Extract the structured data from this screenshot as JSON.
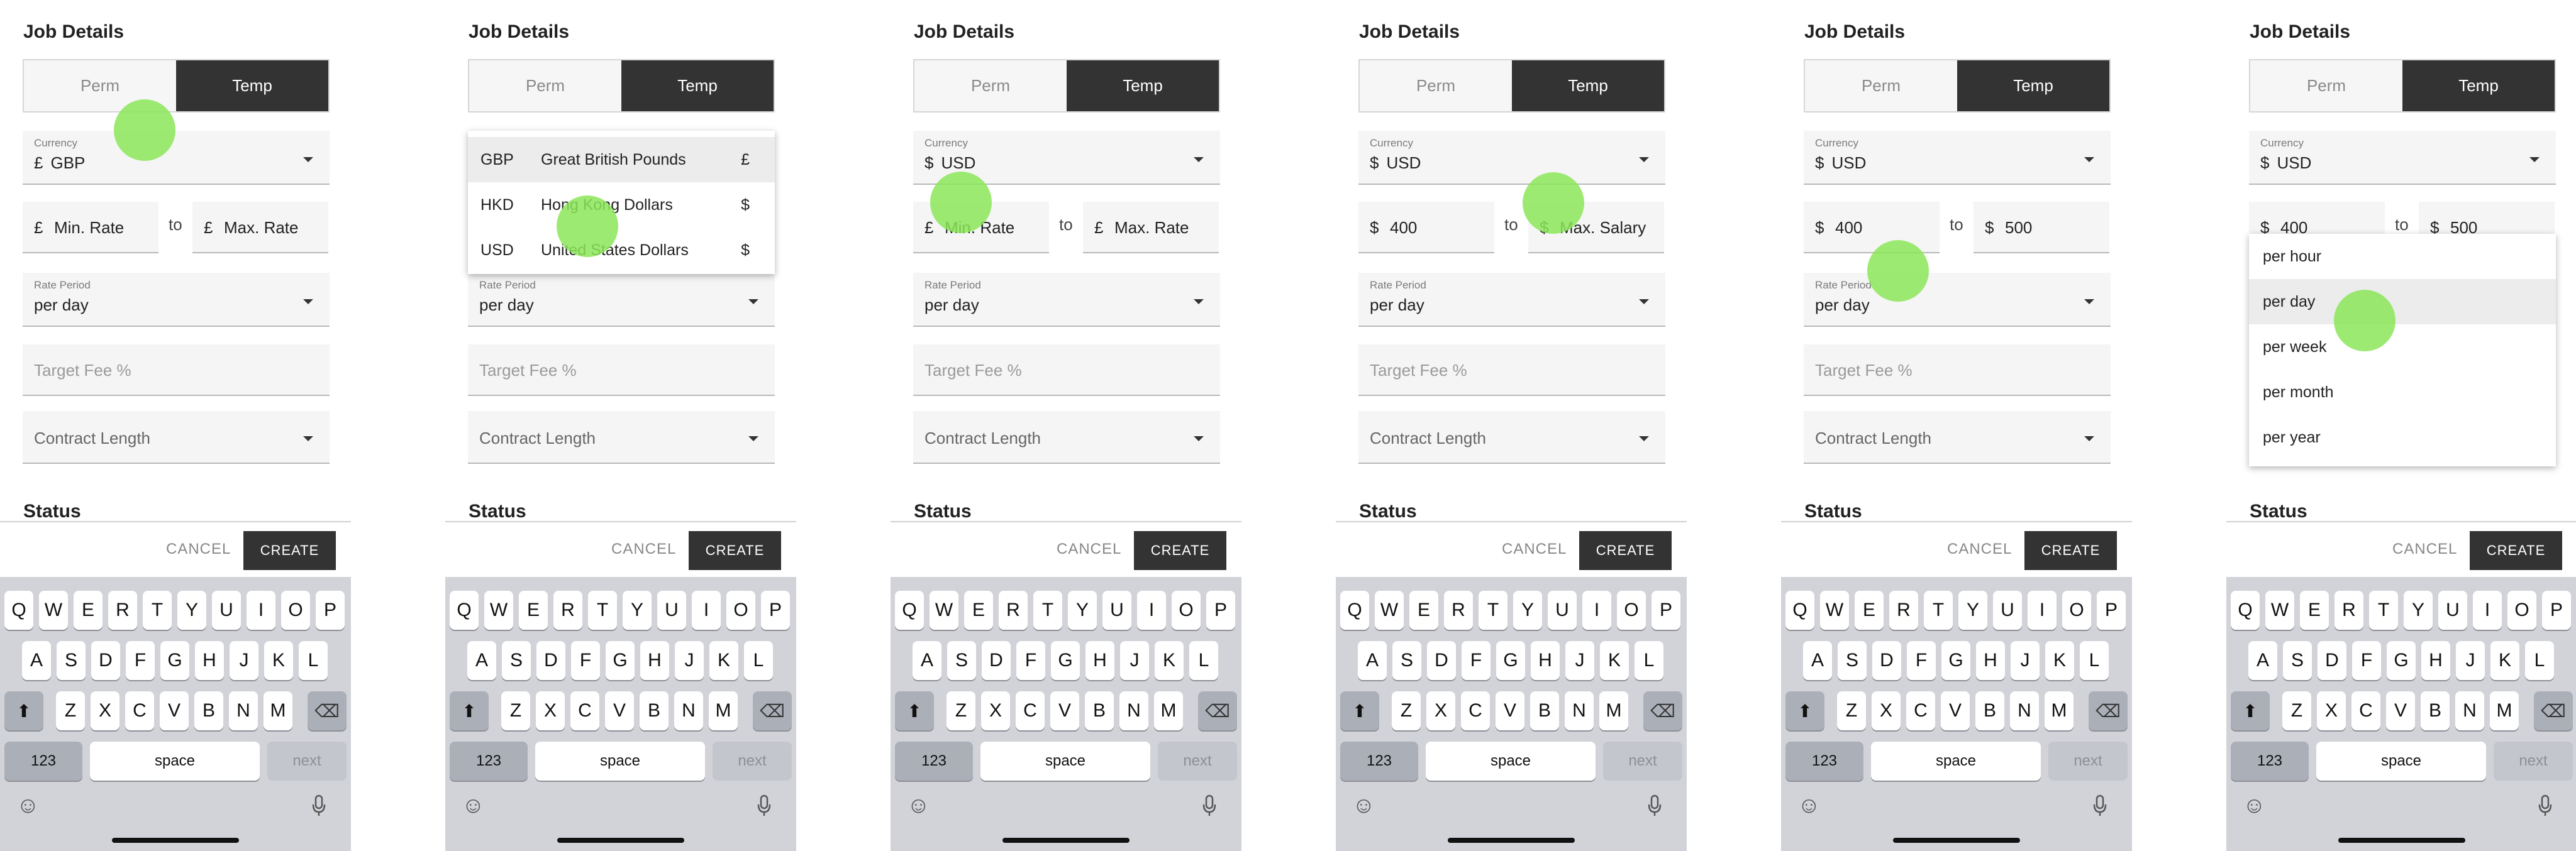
{
  "form": {
    "job_details": "Job Details",
    "perm": "Perm",
    "temp": "Temp",
    "currency_label": "Currency",
    "to": "to",
    "min_rate_placeholder": "Min. Rate",
    "max_rate_placeholder": "Max. Rate",
    "max_salary_placeholder": "Max. Salary",
    "rate_period_label": "Rate Period",
    "rate_period_value": "per day",
    "target_fee_placeholder": "Target Fee %",
    "contract_length_placeholder": "Contract Length",
    "status": "Status",
    "cancel": "CANCEL",
    "create": "CREATE"
  },
  "panels": [
    {
      "currency_symbol": "£",
      "currency_code": "GBP",
      "min_symbol": "£",
      "min_value": "",
      "max_symbol": "£",
      "max_value": ""
    },
    {
      "currency_symbol": "£",
      "currency_code": "GBP",
      "min_symbol": "£",
      "min_value": "",
      "max_symbol": "£",
      "max_value": ""
    },
    {
      "currency_symbol": "$",
      "currency_code": "USD",
      "min_symbol": "£",
      "min_value": "",
      "max_symbol": "£",
      "max_value": ""
    },
    {
      "currency_symbol": "$",
      "currency_code": "USD",
      "min_symbol": "$",
      "min_value": "400",
      "max_symbol": "$",
      "max_value": ""
    },
    {
      "currency_symbol": "$",
      "currency_code": "USD",
      "min_symbol": "$",
      "min_value": "400",
      "max_symbol": "$",
      "max_value": "500"
    },
    {
      "currency_symbol": "$",
      "currency_code": "USD",
      "min_symbol": "$",
      "min_value": "400",
      "max_symbol": "$",
      "max_value": "500"
    }
  ],
  "currency_dropdown": [
    {
      "code": "GBP",
      "name": "Great British Pounds",
      "symbol": "£"
    },
    {
      "code": "HKD",
      "name": "Hong Kong Dollars",
      "symbol": "$"
    },
    {
      "code": "USD",
      "name": "United States Dollars",
      "symbol": "$"
    }
  ],
  "period_dropdown": [
    "per hour",
    "per day",
    "per week",
    "per month",
    "per year"
  ],
  "keyboard": {
    "row1": [
      "Q",
      "W",
      "E",
      "R",
      "T",
      "Y",
      "U",
      "I",
      "O",
      "P"
    ],
    "row2": [
      "A",
      "S",
      "D",
      "F",
      "G",
      "H",
      "J",
      "K",
      "L"
    ],
    "row3": [
      "Z",
      "X",
      "C",
      "V",
      "B",
      "N",
      "M"
    ],
    "num_key": "123",
    "space_key": "space",
    "next_key": "next",
    "shift_icon": "shift-icon",
    "backspace_icon": "backspace-icon",
    "emoji_icon": "emoji-icon",
    "mic_icon": "microphone-icon"
  },
  "colors": {
    "accent_dark": "#333333",
    "touch_indicator": "#8ce65a",
    "keyboard_bg": "#d1d3d9"
  }
}
